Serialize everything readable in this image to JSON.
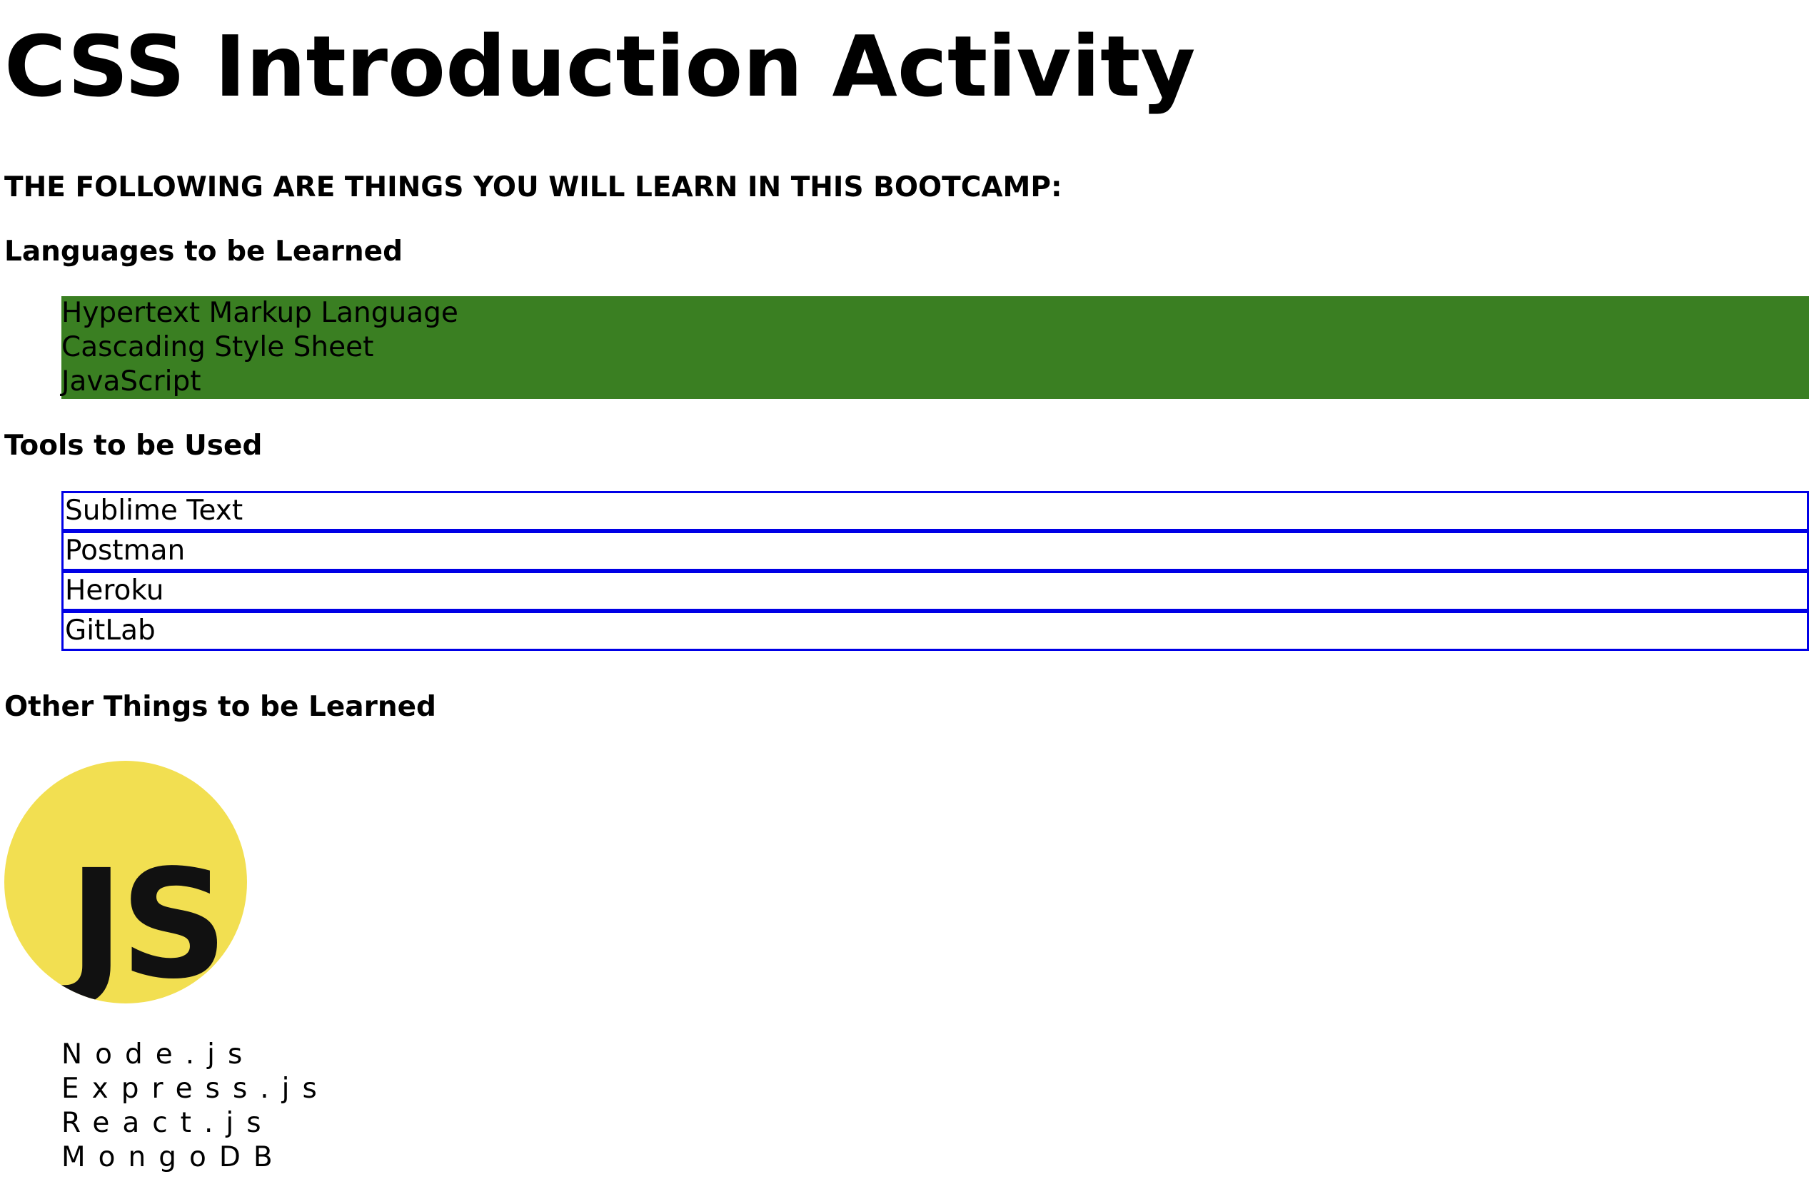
{
  "page": {
    "title": "CSS Introduction Activity",
    "subtitle": "THE FOLLOWING ARE THINGS YOU WILL LEARN IN THIS BOOTCAMP:"
  },
  "languages": {
    "heading": "Languages to be Learned",
    "background_color": "#3a7f22",
    "items": [
      "Hypertext Markup Language",
      "Cascading Style Sheet",
      "JavaScript"
    ]
  },
  "tools": {
    "heading": "Tools to be Used",
    "border_color": "#0000e6",
    "items": [
      "Sublime Text",
      "Postman",
      "Heroku",
      "GitLab"
    ]
  },
  "other": {
    "heading": "Other Things to be Learned",
    "logo": {
      "icon": "javascript-logo-icon",
      "text": "JS",
      "color": "#f2df51"
    },
    "items": [
      "Node.js",
      "Express.js",
      "React.js",
      "MongoDB"
    ]
  }
}
